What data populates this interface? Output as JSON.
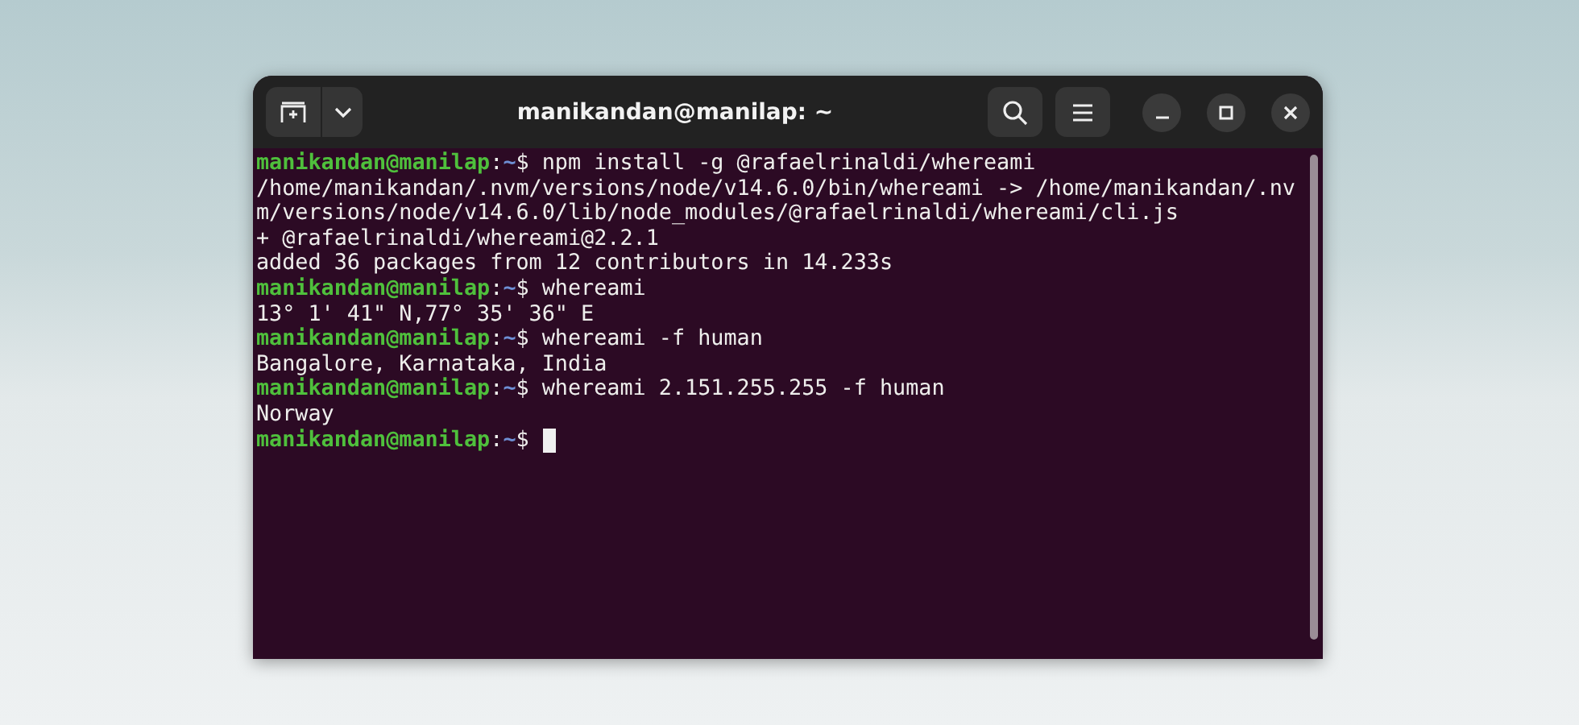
{
  "window": {
    "title": "manikandan@manilap: ~"
  },
  "terminal": {
    "lines": [
      {
        "kind": "prompt",
        "user_host": "manikandan@manilap",
        "separator": ":",
        "path": "~",
        "symbol": "$",
        "command": "npm install -g @rafaelrinaldi/whereami"
      },
      {
        "kind": "output",
        "text": "/home/manikandan/.nvm/versions/node/v14.6.0/bin/whereami -> /home/manikandan/.nv"
      },
      {
        "kind": "output",
        "text": "m/versions/node/v14.6.0/lib/node_modules/@rafaelrinaldi/whereami/cli.js"
      },
      {
        "kind": "output",
        "text": "+ @rafaelrinaldi/whereami@2.2.1"
      },
      {
        "kind": "output",
        "text": "added 36 packages from 12 contributors in 14.233s"
      },
      {
        "kind": "prompt",
        "user_host": "manikandan@manilap",
        "separator": ":",
        "path": "~",
        "symbol": "$",
        "command": "whereami"
      },
      {
        "kind": "output",
        "text": "13° 1' 41\" N,77° 35' 36\" E"
      },
      {
        "kind": "prompt",
        "user_host": "manikandan@manilap",
        "separator": ":",
        "path": "~",
        "symbol": "$",
        "command": "whereami -f human"
      },
      {
        "kind": "output",
        "text": "Bangalore, Karnataka, India"
      },
      {
        "kind": "prompt",
        "user_host": "manikandan@manilap",
        "separator": ":",
        "path": "~",
        "symbol": "$",
        "command": "whereami 2.151.255.255 -f human"
      },
      {
        "kind": "output",
        "text": "Norway"
      },
      {
        "kind": "prompt",
        "user_host": "manikandan@manilap",
        "separator": ":",
        "path": "~",
        "symbol": "$",
        "cursor": true
      }
    ]
  }
}
